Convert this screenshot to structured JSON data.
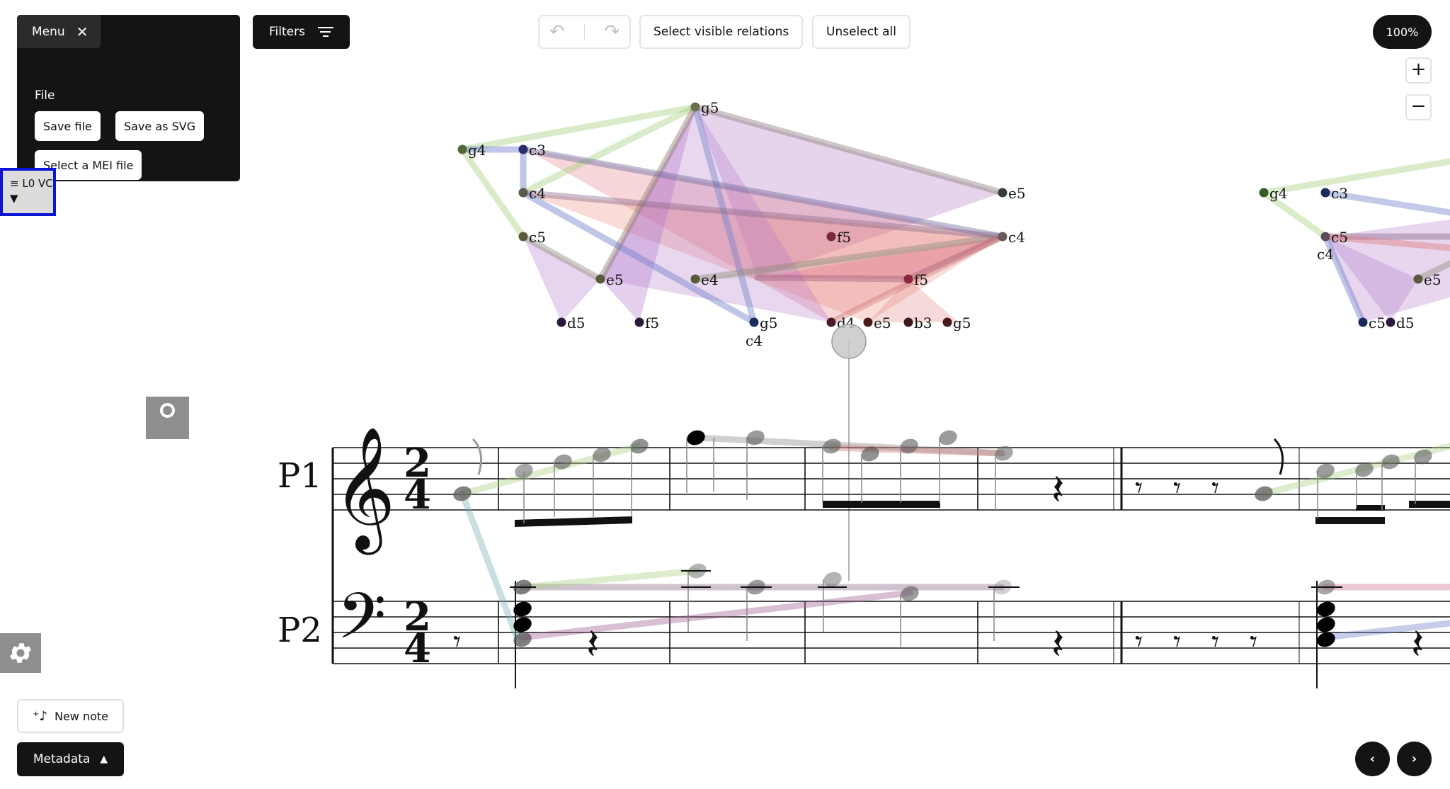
{
  "menu": {
    "label": "Menu",
    "file_label": "File",
    "save_file": "Save file",
    "save_svg": "Save as SVG",
    "select_mei": "Select a MEI file"
  },
  "filters": {
    "label": "Filters"
  },
  "toolbar": {
    "select_visible": "Select visible relations",
    "unselect_all": "Unselect all"
  },
  "zoom": {
    "level": "100%",
    "plus": "+",
    "minus": "−"
  },
  "level_tag": {
    "line1": "≡ L0 VC",
    "line2": "▼"
  },
  "bottom": {
    "new_note": "New note",
    "metadata": "Metadata",
    "prev": "‹",
    "next": "›"
  },
  "score": {
    "part1": "P1",
    "part2": "P2",
    "time_top": "2",
    "time_bottom": "4"
  },
  "graph": {
    "nodes": [
      {
        "label": "g5"
      },
      {
        "label": "g4"
      },
      {
        "label": "c3"
      },
      {
        "label": "c4"
      },
      {
        "label": "e5"
      },
      {
        "label": "c5"
      },
      {
        "label": "f5"
      },
      {
        "label": "c4"
      },
      {
        "label": "e5"
      },
      {
        "label": "e4"
      },
      {
        "label": "f5"
      },
      {
        "label": "d5"
      },
      {
        "label": "f5"
      },
      {
        "label": "g5"
      },
      {
        "label": "c4"
      },
      {
        "label": "d4"
      },
      {
        "label": "e5"
      },
      {
        "label": "b3"
      },
      {
        "label": "g5"
      },
      {
        "label": "g4"
      },
      {
        "label": "c3"
      },
      {
        "label": "c5"
      },
      {
        "label": "c4"
      },
      {
        "label": "e5"
      },
      {
        "label": "c5"
      },
      {
        "label": "d5"
      }
    ]
  }
}
